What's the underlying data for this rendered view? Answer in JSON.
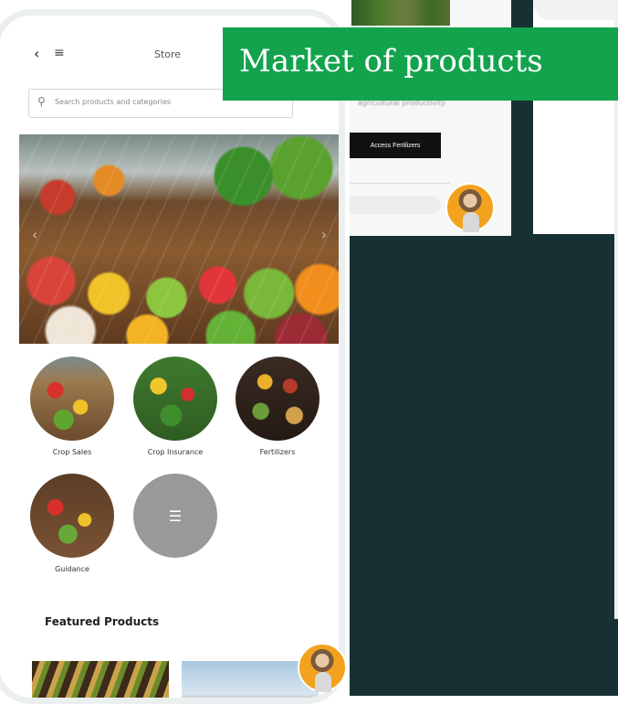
{
  "banner": {
    "title": "Market of products"
  },
  "topbar": {
    "title": "Store",
    "back_icon": "chevron-left-icon",
    "menu_icon": "hamburger-menu-icon"
  },
  "search": {
    "placeholder": "Search products and categories"
  },
  "categories": [
    {
      "label": "Crop Sales"
    },
    {
      "label": "Crop Insurance"
    },
    {
      "label": "Fertilizers"
    },
    {
      "label": "Guidance"
    }
  ],
  "more_icon": "list-icon",
  "featured": {
    "title": "Featured Products"
  },
  "background_screen": {
    "text": "agricultural productivity",
    "button_label": "Access Fertilizers"
  },
  "colors": {
    "banner": "#14a34d",
    "dark_panel": "#163034",
    "more_circle": "#999999"
  }
}
